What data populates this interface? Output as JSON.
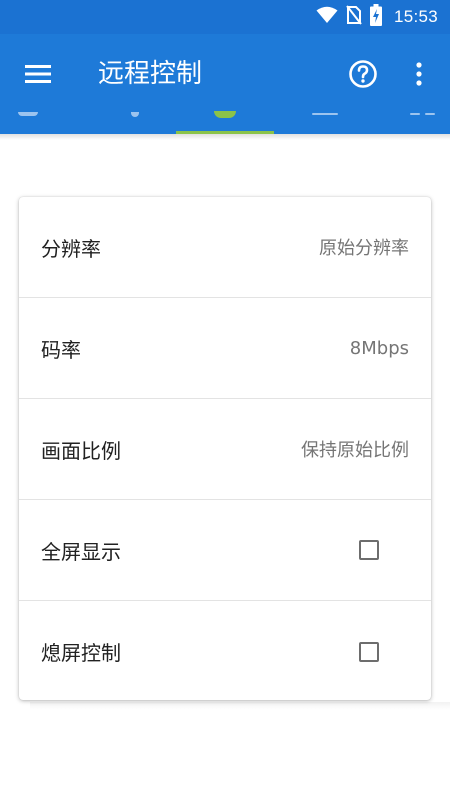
{
  "status_bar": {
    "time": "15:53",
    "icons": [
      "wifi-icon",
      "no-sim-icon",
      "battery-charging-icon"
    ]
  },
  "toolbar": {
    "title": "远程控制",
    "left_icon": "menu-icon",
    "right_icons": [
      "help-icon",
      "more-vert-icon"
    ]
  },
  "colors": {
    "status_bar": "#1b72d2",
    "toolbar": "#1e7ad8",
    "tab_indicator": "#8bc34a"
  },
  "settings": {
    "resolution": {
      "label": "分辨率",
      "value": "原始分辨率"
    },
    "bitrate": {
      "label": "码率",
      "value": "8Mbps"
    },
    "aspect_ratio": {
      "label": "画面比例",
      "value": "保持原始比例"
    },
    "fullscreen": {
      "label": "全屏显示",
      "checked": false
    },
    "screen_off": {
      "label": "熄屏控制",
      "checked": false
    }
  }
}
